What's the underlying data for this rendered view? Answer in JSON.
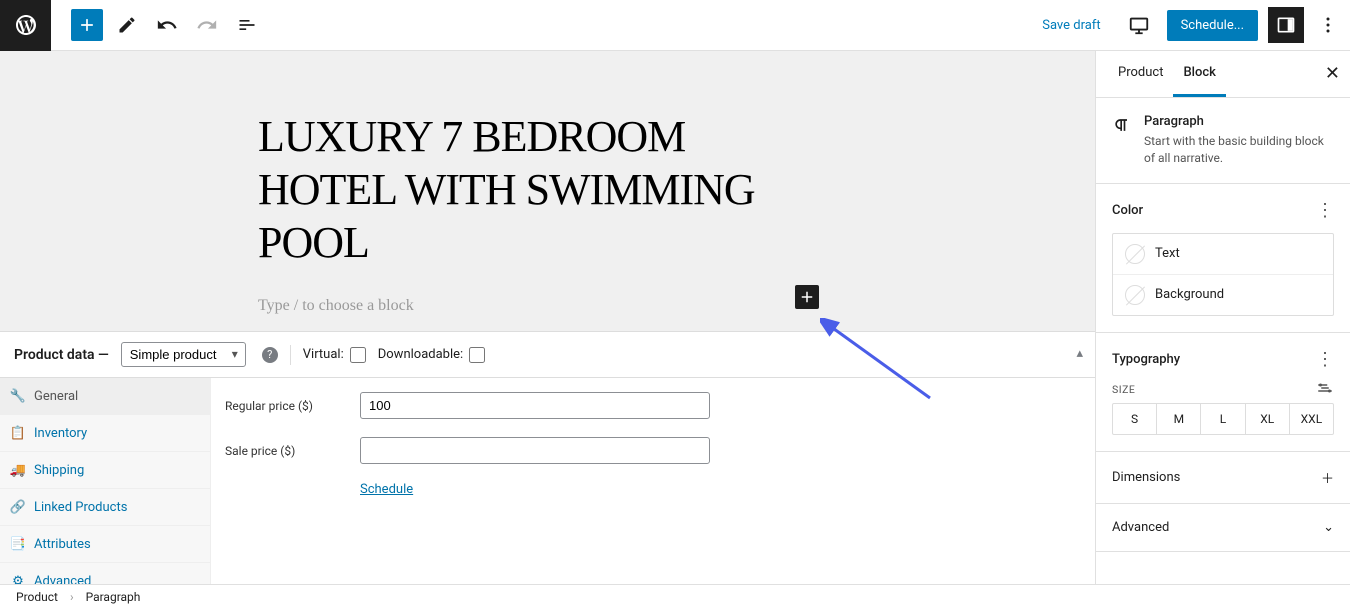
{
  "toolbar": {
    "save_draft": "Save draft",
    "schedule": "Schedule..."
  },
  "editor": {
    "title": "LUXURY 7 BEDROOM HOTEL WITH SWIMMING POOL",
    "block_prompt": "Type / to choose a block"
  },
  "product_data": {
    "label": "Product data —",
    "type_options": [
      "Simple product"
    ],
    "type_selected": "Simple product",
    "virtual_label": "Virtual:",
    "downloadable_label": "Downloadable:",
    "tabs": [
      "General",
      "Inventory",
      "Shipping",
      "Linked Products",
      "Attributes",
      "Advanced"
    ],
    "fields": {
      "regular_price_label": "Regular price ($)",
      "regular_price_value": "100",
      "sale_price_label": "Sale price ($)",
      "sale_price_value": "",
      "schedule_link": "Schedule"
    }
  },
  "sidebar": {
    "tabs": {
      "product": "Product",
      "block": "Block"
    },
    "block_info": {
      "name": "Paragraph",
      "desc": "Start with the basic building block of all narrative."
    },
    "panels": {
      "color": {
        "title": "Color",
        "options": {
          "text": "Text",
          "background": "Background"
        }
      },
      "typography": {
        "title": "Typography",
        "size_label": "SIZE",
        "sizes": [
          "S",
          "M",
          "L",
          "XL",
          "XXL"
        ]
      },
      "dimensions": "Dimensions",
      "advanced": "Advanced"
    }
  },
  "breadcrumb": {
    "root": "Product",
    "current": "Paragraph"
  }
}
